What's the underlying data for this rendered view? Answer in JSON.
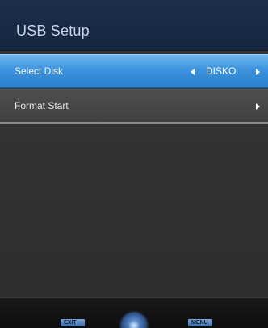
{
  "header": {
    "title": "USB Setup"
  },
  "menu": {
    "items": [
      {
        "label": "Select Disk",
        "value": "DISKO",
        "selected": true
      },
      {
        "label": "Format Start",
        "selected": false
      }
    ]
  },
  "footer": {
    "exit_label": "EXIT",
    "menu_label": "MENU",
    "icons": [
      "dpad-icon"
    ]
  },
  "colors": {
    "accent": "#3d93dd",
    "header_bg": "#1b2e4a",
    "panel_bg": "#333333"
  }
}
